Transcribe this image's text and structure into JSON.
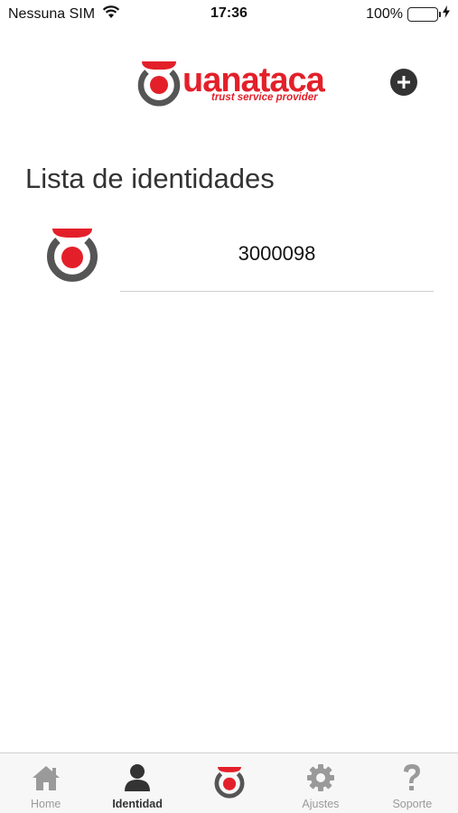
{
  "status_bar": {
    "carrier": "Nessuna SIM",
    "time": "17:36",
    "battery_percent": "100%",
    "battery_level": 1.0,
    "icons": [
      "wifi-icon",
      "battery-icon",
      "charging-icon"
    ]
  },
  "header": {
    "logo_word": "uanataca",
    "logo_tagline": "trust service provider",
    "add_icon": "plus-circle-icon",
    "brand_color": "#e3202a",
    "dark_color": "#333333"
  },
  "page": {
    "title": "Lista de identidades"
  },
  "identities": [
    {
      "id_text": "3000098",
      "icon": "uanataca-identity-icon"
    }
  ],
  "tab_bar": {
    "items": [
      {
        "label": "Home",
        "icon": "home-icon",
        "active": false
      },
      {
        "label": "Identidad",
        "icon": "person-icon",
        "active": true
      },
      {
        "label": "",
        "icon": "uanataca-logo-icon",
        "active": false
      },
      {
        "label": "Ajustes",
        "icon": "gear-icon",
        "active": false
      },
      {
        "label": "Soporte",
        "icon": "question-icon",
        "active": false
      }
    ]
  }
}
